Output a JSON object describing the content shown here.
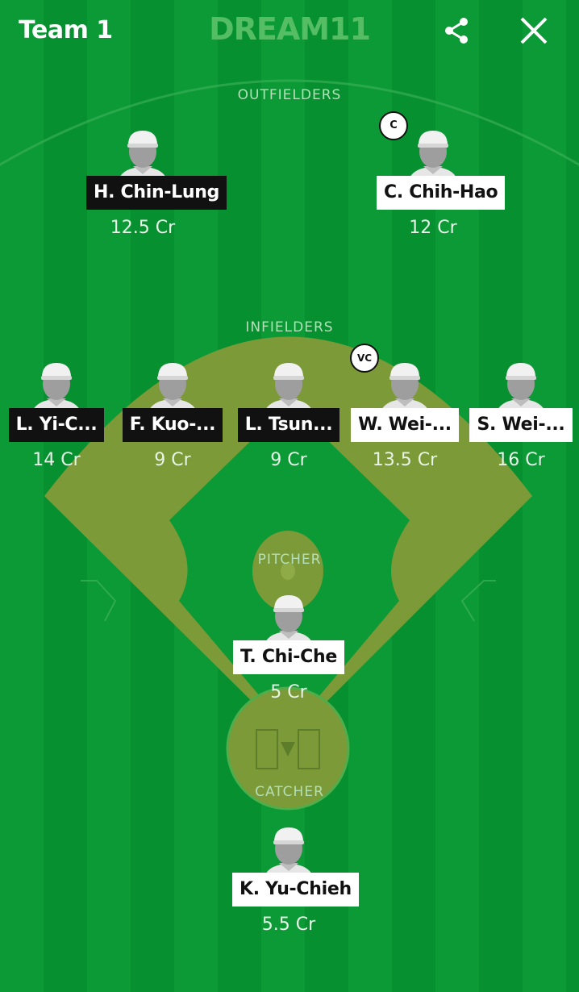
{
  "header": {
    "team_title": "Team 1",
    "brand": "DREAM11",
    "share_icon": "share-icon",
    "close_icon": "close-icon"
  },
  "colors": {
    "field_green": "#0b9a35",
    "stripe_green": "#079030",
    "diamond": "#7c9a37",
    "brand_green": "#55bd63",
    "dark_label": "#111111",
    "light_label": "#ffffff"
  },
  "sections": {
    "outfielders": "OUTFIELDERS",
    "infielders": "INFIELDERS",
    "pitcher": "PITCHER",
    "catcher": "CATCHER"
  },
  "players": {
    "outfielders": [
      {
        "name": "H. Chin-Lung",
        "credits": "12.5 Cr",
        "label_style": "dark",
        "badge": ""
      },
      {
        "name": "C. Chih-Hao",
        "credits": "12 Cr",
        "label_style": "light",
        "badge": "C"
      }
    ],
    "infielders": [
      {
        "name": "L. Yi-C...",
        "credits": "14 Cr",
        "label_style": "dark",
        "badge": ""
      },
      {
        "name": "F. Kuo-...",
        "credits": "9 Cr",
        "label_style": "dark",
        "badge": ""
      },
      {
        "name": "L. Tsun...",
        "credits": "9 Cr",
        "label_style": "dark",
        "badge": ""
      },
      {
        "name": "W. Wei-...",
        "credits": "13.5 Cr",
        "label_style": "light",
        "badge": "VC"
      },
      {
        "name": "S. Wei-...",
        "credits": "16 Cr",
        "label_style": "light",
        "badge": ""
      }
    ],
    "pitcher": [
      {
        "name": "T. Chi-Che",
        "credits": "5 Cr",
        "label_style": "light",
        "badge": ""
      }
    ],
    "catcher": [
      {
        "name": "K. Yu-Chieh",
        "credits": "5.5 Cr",
        "label_style": "light",
        "badge": ""
      }
    ]
  }
}
